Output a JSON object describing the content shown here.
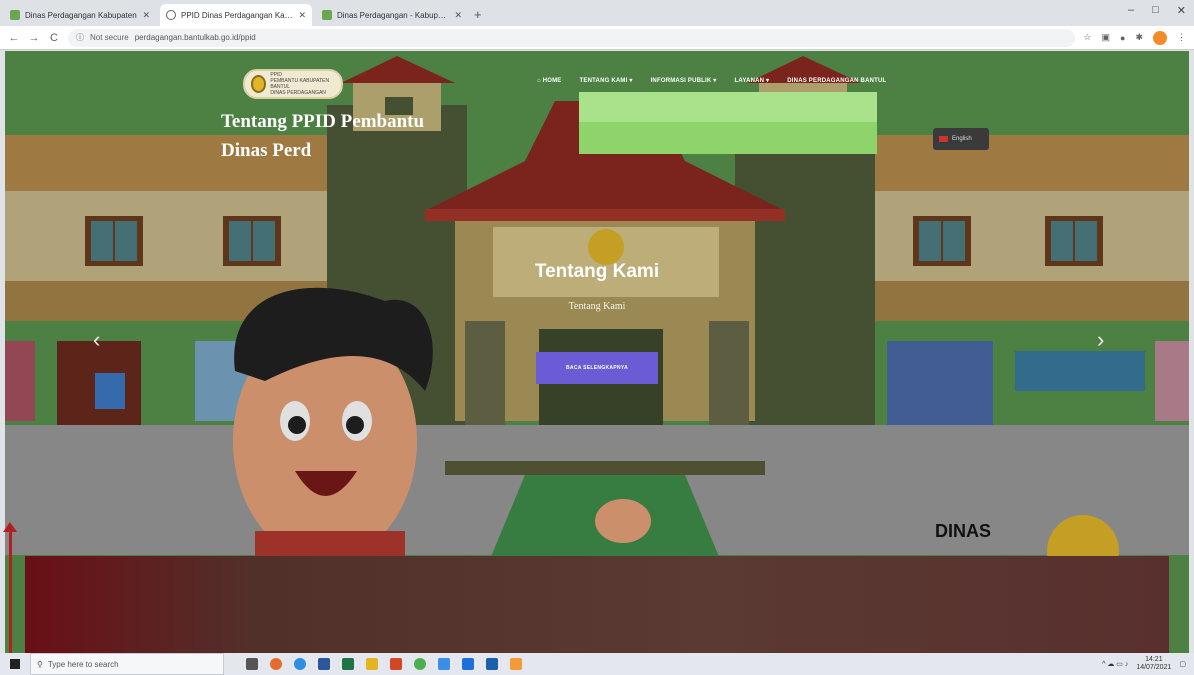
{
  "browser": {
    "tabs": [
      {
        "title": "Dinas Perdagangan Kabupaten",
        "active": false
      },
      {
        "title": "PPID Dinas Perdagangan Kabu",
        "active": true
      },
      {
        "title": "Dinas Perdagangan - Kabupaten",
        "active": false
      }
    ],
    "new_tab": "+",
    "window_controls": [
      "–",
      "□",
      "✕"
    ],
    "nav": {
      "back": "←",
      "forward": "→",
      "reload": "C"
    },
    "address": {
      "security": "Not secure",
      "url": "perdagangan.bantulkab.go.id/ppid"
    }
  },
  "site": {
    "logo_lines": [
      "PPID",
      "PEMBANTU KABUPATEN BANTUL",
      "DINAS PERDAGANGAN"
    ],
    "nav_items": [
      "HOME",
      "TENTANG KAMI",
      "INFORMASI PUBLIK",
      "LAYANAN",
      "DINAS PERDAGANGAN BANTUL"
    ],
    "hero": {
      "title": "Tentang Kami",
      "subtitle": "Tentang Kami",
      "button": "BACA SELENGKAPNYA",
      "prev": "‹",
      "next": "›"
    },
    "watermark": "DINAS",
    "panel": {
      "title_line1": "Tentang PPID Pembantu",
      "title_line2": "Dinas Perd",
      "language": "English"
    }
  },
  "taskbar": {
    "search_placeholder": "Type here to search",
    "time": "14:21",
    "date": "14/07/2021"
  }
}
